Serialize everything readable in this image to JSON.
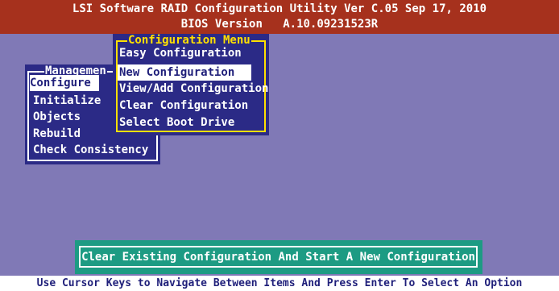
{
  "header": {
    "title": "LSI Software RAID Configuration Utility Ver C.05 Sep 17, 2010",
    "bios_version_label": "BIOS Version",
    "bios_version_value": "A.10.09231523R"
  },
  "management_menu": {
    "title": "Managemen",
    "items": [
      "Configure",
      "Initialize",
      "Objects",
      "Rebuild",
      "Check Consistency"
    ],
    "selected": "Configure"
  },
  "configuration_menu": {
    "title": "Configuration Menu",
    "items": [
      "Easy Configuration",
      "New Configuration",
      "View/Add Configuration",
      "Clear Configuration",
      "Select Boot Drive"
    ],
    "selected": "New Configuration"
  },
  "status": {
    "message": "Clear Existing Configuration And Start A New Configuration"
  },
  "footer": {
    "hint": "Use Cursor Keys to Navigate Between Items And Press Enter To Select An Option"
  },
  "colors": {
    "background": "#8079b6",
    "header": "#a6311d",
    "menu": "#2b2a86",
    "config_border": "#ffe000",
    "status_box": "#1d9b83"
  }
}
